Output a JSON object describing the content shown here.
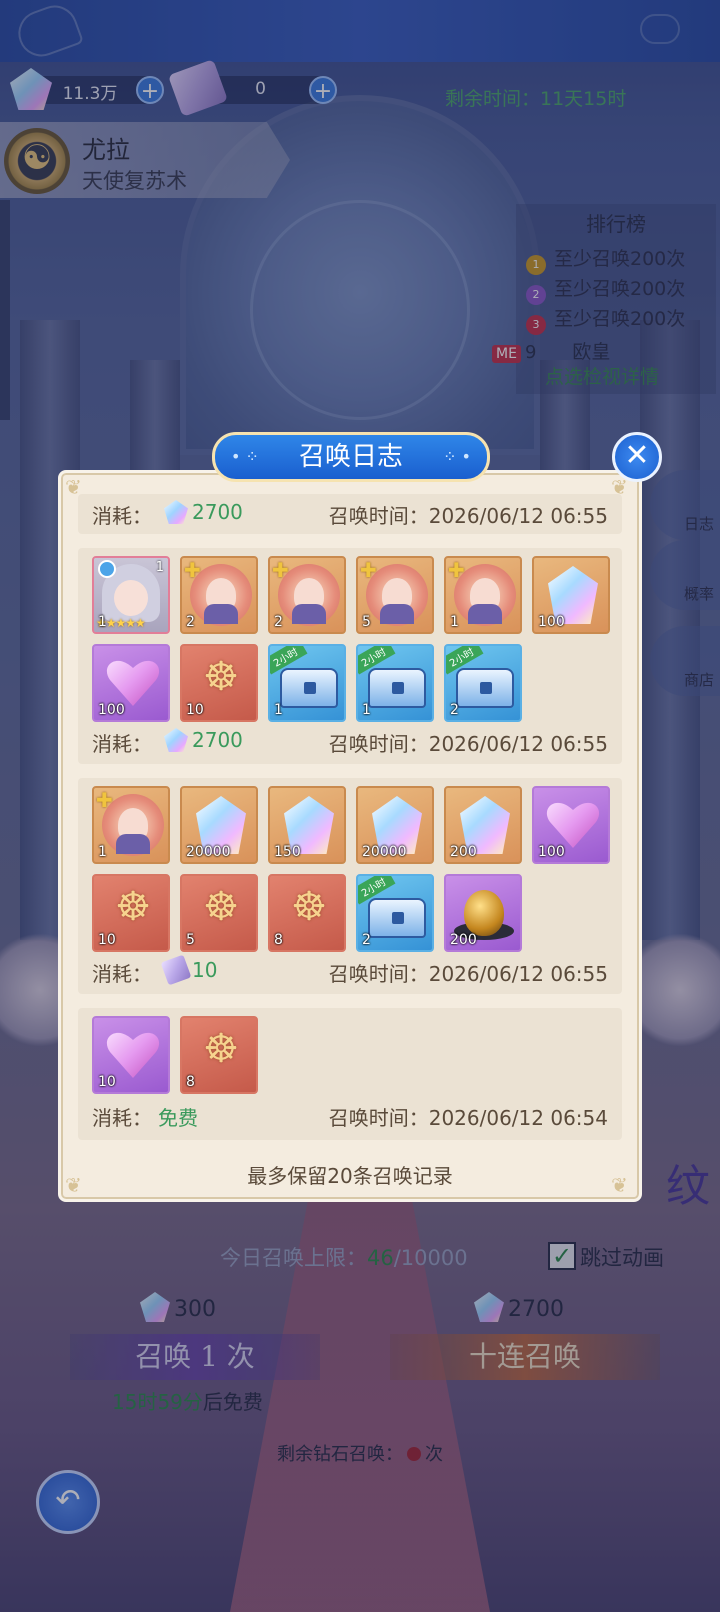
{
  "top": {
    "currency_gem": "11.3万",
    "currency_scroll": "0",
    "remaining_time": "剩余时间：11天15时"
  },
  "character": {
    "name": "尤拉",
    "subtitle": "天使复苏术"
  },
  "ranking": {
    "title": "排行榜",
    "rows": [
      "至少召唤200次",
      "至少召唤200次",
      "至少召唤200次"
    ],
    "me_badge": "ME",
    "me_rank": "9",
    "me_title": "欧皇",
    "detail_link": "点选检视详情"
  },
  "side_buttons": [
    "日志",
    "概率",
    "商店"
  ],
  "modal": {
    "title": "召唤日志",
    "close_icon": "close-icon",
    "footnote": "最多保留20条召唤记录",
    "cost_label": "消耗：",
    "time_label": "召唤时间：",
    "records": [
      {
        "cost_type": "gem",
        "cost": "2700",
        "time": "2026/06/12 06:55"
      },
      {
        "cost_type": "gem",
        "cost": "2700",
        "time": "2026/06/12 06:55",
        "items": [
          {
            "kind": "portrait",
            "qty": "1"
          },
          {
            "kind": "shard",
            "qty": "2"
          },
          {
            "kind": "shard",
            "qty": "2"
          },
          {
            "kind": "shard",
            "qty": "5"
          },
          {
            "kind": "shard",
            "qty": "1"
          },
          {
            "kind": "diamond",
            "qty": "100"
          },
          {
            "kind": "heart",
            "qty": "100"
          },
          {
            "kind": "dragon",
            "qty": "10"
          },
          {
            "kind": "chest",
            "qty": "1",
            "ribbon": "2小时"
          },
          {
            "kind": "chest",
            "qty": "1",
            "ribbon": "2小时"
          },
          {
            "kind": "chest",
            "qty": "2",
            "ribbon": "2小时"
          }
        ]
      },
      {
        "cost_type": "scroll",
        "cost": "10",
        "time": "2026/06/12 06:55",
        "items": [
          {
            "kind": "shard",
            "qty": "1"
          },
          {
            "kind": "diamond",
            "qty": "20000"
          },
          {
            "kind": "diamond",
            "qty": "150"
          },
          {
            "kind": "diamond",
            "qty": "20000"
          },
          {
            "kind": "diamond",
            "qty": "200"
          },
          {
            "kind": "heart",
            "qty": "100"
          },
          {
            "kind": "dragon",
            "qty": "10"
          },
          {
            "kind": "dragon",
            "qty": "5"
          },
          {
            "kind": "dragon",
            "qty": "8"
          },
          {
            "kind": "chest",
            "qty": "2",
            "ribbon": "2小时"
          },
          {
            "kind": "egg",
            "qty": "200"
          }
        ]
      },
      {
        "cost_type": "free",
        "cost": "免费",
        "time": "2026/06/12 06:54",
        "items": [
          {
            "kind": "heart",
            "qty": "10"
          },
          {
            "kind": "dragon",
            "qty": "8"
          }
        ]
      }
    ]
  },
  "bottom": {
    "daily_limit_prefix": "今日召唤上限：",
    "daily_limit_used": "46",
    "daily_limit_total": "/10000",
    "skip_label": "跳过动画",
    "price_one": "300",
    "price_ten": "2700",
    "summon_one": "召唤 1 次",
    "summon_ten": "十连召唤",
    "free_timer": "15时59分",
    "free_suffix": "后免费",
    "remain_diamond_prefix": "剩余钻石召唤：",
    "remain_diamond_suffix": "次",
    "bg_glyph": "纹"
  },
  "colors": {
    "accent_blue": "#1a5fcf",
    "green_text": "#3a9a5c",
    "modal_bg": "#f4ecdf"
  }
}
